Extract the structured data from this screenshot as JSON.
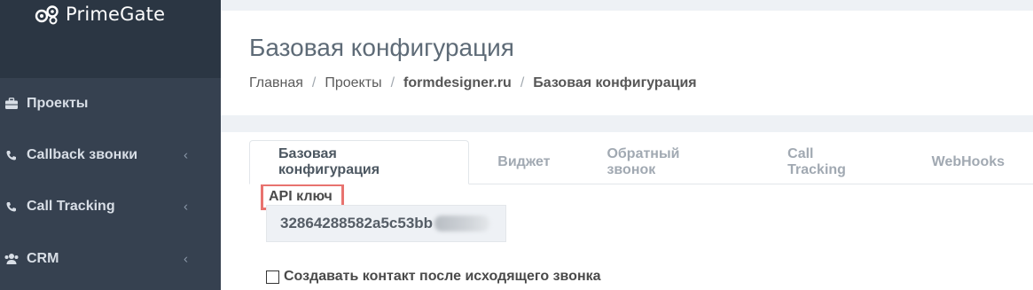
{
  "brand": {
    "name": "PrimeGate"
  },
  "sidebar": {
    "items": [
      {
        "label": "Проекты",
        "icon": "briefcase-icon",
        "has_arrow": false
      },
      {
        "label": "Callback звонки",
        "icon": "phone-volume-icon",
        "has_arrow": true
      },
      {
        "label": "Call Tracking",
        "icon": "phone-volume-icon",
        "has_arrow": true
      },
      {
        "label": "CRM",
        "icon": "users-icon",
        "has_arrow": true
      }
    ],
    "arrow_glyph": "‹"
  },
  "header": {
    "title": "Базовая конфигурация",
    "breadcrumb": [
      "Главная",
      "Проекты",
      "formdesigner.ru",
      "Базовая конфигурация"
    ],
    "breadcrumb_sep": "/"
  },
  "tabs": [
    {
      "label": "Базовая конфигурация",
      "active": true
    },
    {
      "label": "Виджет",
      "active": false
    },
    {
      "label": "Обратный звонок",
      "active": false
    },
    {
      "label": "Call Tracking",
      "active": false
    },
    {
      "label": "WebHooks",
      "active": false
    }
  ],
  "form": {
    "api_key_label": "API ключ",
    "api_key_value": "32864288582a5c53bb",
    "checkbox_label": "Создавать контакт после исходящего звонка",
    "checkbox_checked": false
  },
  "colors": {
    "sidebar_bg": "#364150",
    "logo_bg": "#2b3643",
    "highlight_border": "#e8736f"
  }
}
